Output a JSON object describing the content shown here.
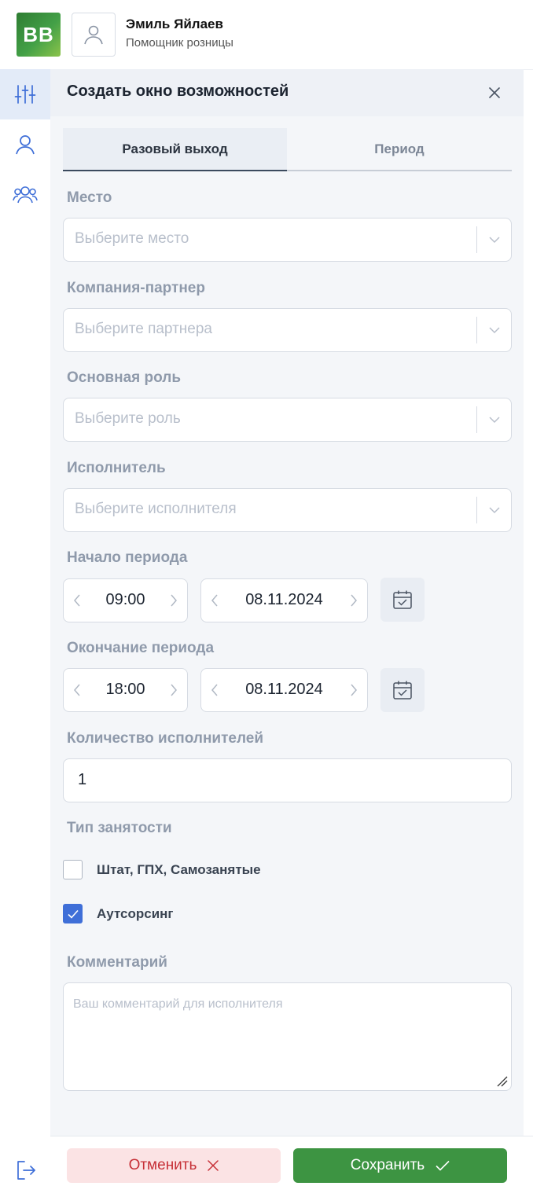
{
  "header": {
    "logo_text": "BB",
    "user_name": "Эмиль Яйлаев",
    "user_role": "Помощник розницы"
  },
  "sidebar": {
    "items": [
      {
        "icon": "sliders-icon",
        "active": true
      },
      {
        "icon": "user-icon",
        "active": false
      },
      {
        "icon": "users-group-icon",
        "active": false
      }
    ],
    "logout_icon": "logout-icon"
  },
  "panel": {
    "title": "Создать окно возможностей",
    "tabs": [
      {
        "label": "Разовый выход",
        "active": true
      },
      {
        "label": "Период",
        "active": false
      }
    ],
    "place": {
      "label": "Место",
      "placeholder": "Выберите место"
    },
    "partner": {
      "label": "Компания-партнер",
      "placeholder": "Выберите партнера"
    },
    "role": {
      "label": "Основная роль",
      "placeholder": "Выберите роль"
    },
    "executor": {
      "label": "Исполнитель",
      "placeholder": "Выберите исполнителя"
    },
    "start": {
      "label": "Начало периода",
      "time": "09:00",
      "date": "08.11.2024"
    },
    "end": {
      "label": "Окончание периода",
      "time": "18:00",
      "date": "08.11.2024"
    },
    "count": {
      "label": "Количество исполнителей",
      "value": "1"
    },
    "employment": {
      "label": "Тип занятости",
      "options": [
        {
          "label": "Штат, ГПХ, Самозанятые",
          "checked": false
        },
        {
          "label": "Аутсорсинг",
          "checked": true
        }
      ]
    },
    "comment": {
      "label": "Комментарий",
      "placeholder": "Ваш комментарий для исполнителя"
    }
  },
  "footer": {
    "cancel_label": "Отменить",
    "save_label": "Сохранить"
  },
  "colors": {
    "accent": "#3f6fd8",
    "save": "#3d9442",
    "cancel_bg": "#fbe3e4",
    "cancel_text": "#c62f36"
  }
}
